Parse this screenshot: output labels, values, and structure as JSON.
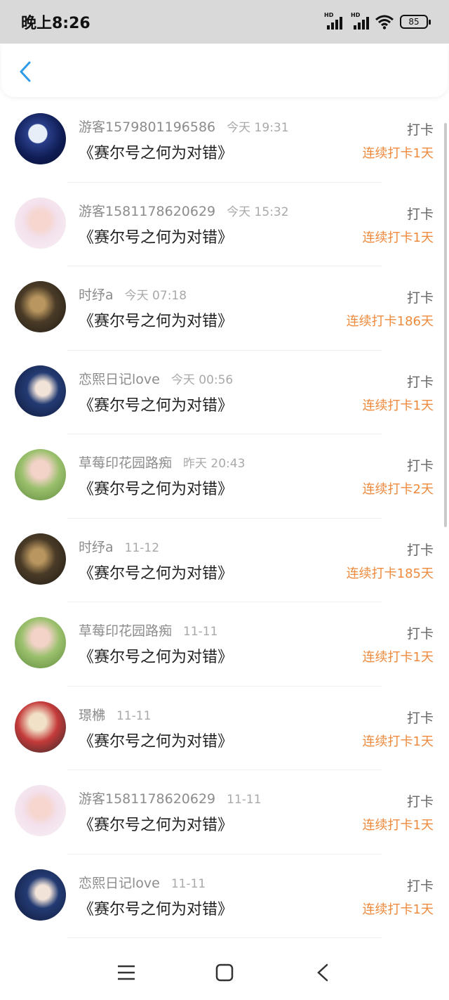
{
  "status": {
    "time": "晚上8:26",
    "battery": "85",
    "signal_label": "HD"
  },
  "items": [
    {
      "name": "游客1579801196586",
      "time": "今天 19:31",
      "title": "《赛尔号之何为对错》",
      "tag": "打卡",
      "streak": "连续打卡1天"
    },
    {
      "name": "游客1581178620629",
      "time": "今天 15:32",
      "title": "《赛尔号之何为对错》",
      "tag": "打卡",
      "streak": "连续打卡1天"
    },
    {
      "name": "时纾a",
      "time": "今天 07:18",
      "title": "《赛尔号之何为对错》",
      "tag": "打卡",
      "streak": "连续打卡186天"
    },
    {
      "name": "恋熙日记love",
      "time": "今天 00:56",
      "title": "《赛尔号之何为对错》",
      "tag": "打卡",
      "streak": "连续打卡1天"
    },
    {
      "name": "草莓印花园路痴",
      "time": "昨天 20:43",
      "title": "《赛尔号之何为对错》",
      "tag": "打卡",
      "streak": "连续打卡2天"
    },
    {
      "name": "时纾a",
      "time": "11-12",
      "title": "《赛尔号之何为对错》",
      "tag": "打卡",
      "streak": "连续打卡185天"
    },
    {
      "name": "草莓印花园路痴",
      "time": "11-11",
      "title": "《赛尔号之何为对错》",
      "tag": "打卡",
      "streak": "连续打卡1天"
    },
    {
      "name": "璟梻",
      "time": "11-11",
      "title": "《赛尔号之何为对错》",
      "tag": "打卡",
      "streak": "连续打卡1天"
    },
    {
      "name": "游客1581178620629",
      "time": "11-11",
      "title": "《赛尔号之何为对错》",
      "tag": "打卡",
      "streak": "连续打卡1天"
    },
    {
      "name": "恋熙日记love",
      "time": "11-11",
      "title": "《赛尔号之何为对错》",
      "tag": "打卡",
      "streak": "连续打卡1天"
    }
  ],
  "colors": {
    "streak": "#ee8a3d",
    "back": "#2f9be8",
    "status_bg": "#d9d9d9"
  },
  "icons": {
    "back": "chevron-left-icon",
    "menu": "menu-icon",
    "home": "home-icon",
    "nav_back": "back-icon"
  }
}
